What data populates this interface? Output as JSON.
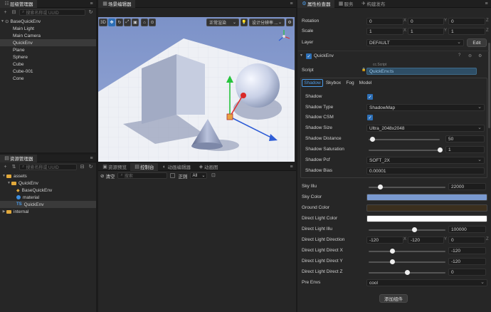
{
  "hierarchy": {
    "title": "层级管理器",
    "search_placeholder": "搜索名称或 UUID",
    "root": "BaseQuickEnv",
    "items": [
      "Main Light",
      "Main Camera",
      "QuickEnv",
      "Plane",
      "Sphere",
      "Cube",
      "Cube-001",
      "Cone"
    ],
    "selected_index": 2
  },
  "assets": {
    "title": "资源管理器",
    "search_placeholder": "搜索名称或 UUID",
    "items": [
      {
        "label": "assets",
        "depth": 0,
        "icon": "folder-icon",
        "expanded": true
      },
      {
        "label": "QuickEnv",
        "depth": 1,
        "icon": "folder-icon",
        "expanded": true
      },
      {
        "label": "BaseQuickEnv",
        "depth": 2,
        "icon": "scene-icon"
      },
      {
        "label": "material",
        "depth": 2,
        "icon": "material-icon"
      },
      {
        "label": "QuickEnv",
        "depth": 2,
        "icon": "ts-icon",
        "sel": true
      },
      {
        "label": "internal",
        "depth": 0,
        "icon": "folder-icon",
        "expanded": false
      }
    ],
    "ts_prefix": "TS"
  },
  "scene": {
    "title": "场景编辑器",
    "mode_3d": "3D",
    "render_mode": "正常渲染",
    "resolution": "设计分辨率 ..."
  },
  "console": {
    "tabs": [
      "资源预览",
      "控制台",
      "动画编辑器",
      "动画图"
    ],
    "active_tab": 1,
    "clear": "清空",
    "search_placeholder": "搜索",
    "regex": "正则",
    "level": "All"
  },
  "inspector": {
    "tabs": [
      "属性检查器",
      "服务",
      "构建发布"
    ],
    "rotation": {
      "label": "Rotation",
      "x": "0",
      "y": "0",
      "z": "0"
    },
    "scale": {
      "label": "Scale",
      "x": "1",
      "y": "1",
      "z": "1"
    },
    "layer": {
      "label": "Layer",
      "value": "DEFAULT",
      "edit": "Edit"
    },
    "component": "QuickEnv",
    "script": {
      "label": "Script",
      "badge": "cc.Script",
      "value": "QuickEnv.ts"
    },
    "subtabs": [
      "Shadow",
      "Skybox",
      "Fog",
      "Model"
    ],
    "shadow": {
      "shadow": {
        "label": "Shadow",
        "checked": true
      },
      "type": {
        "label": "Shadow Type",
        "value": "ShadowMap"
      },
      "csm": {
        "label": "Shadow CSM",
        "checked": true
      },
      "size": {
        "label": "Shadow Size",
        "value": "Ultra_2048x2048"
      },
      "distance": {
        "label": "Shadow Distance",
        "value": "50",
        "fraction": 0.05
      },
      "saturation": {
        "label": "Shadow Saturation",
        "value": "1",
        "fraction": 1.0
      },
      "pcf": {
        "label": "Shadow Pcf",
        "value": "SOFT_2X"
      },
      "bias": {
        "label": "Shadow Bias",
        "value": "0.00001"
      }
    },
    "sky_illu": {
      "label": "Sky Illu",
      "value": "22000",
      "fraction": 0.15
    },
    "sky_color": {
      "label": "Sky Color",
      "color": "#7a9ad0"
    },
    "ground_color": {
      "label": "Ground Color",
      "color": "#3b2f1e"
    },
    "dl_color": {
      "label": "Direct Light Color",
      "color": "#ffffff"
    },
    "dl_illu": {
      "label": "Direct Light Illu",
      "value": "100000",
      "fraction": 0.6
    },
    "dl_direction": {
      "label": "Direct Light Direction",
      "x": "-120",
      "y": "-120",
      "z": "0"
    },
    "dl_x": {
      "label": "Direct Light Direct X",
      "value": "-120",
      "fraction": 0.31
    },
    "dl_y": {
      "label": "Direct Light Direct Y",
      "value": "-120",
      "fraction": 0.31
    },
    "dl_z": {
      "label": "Direct Light Direct Z",
      "value": "0",
      "fraction": 0.5
    },
    "pre_envs": {
      "label": "Pre Envs",
      "value": "cool"
    },
    "add_component": "添加组件"
  }
}
